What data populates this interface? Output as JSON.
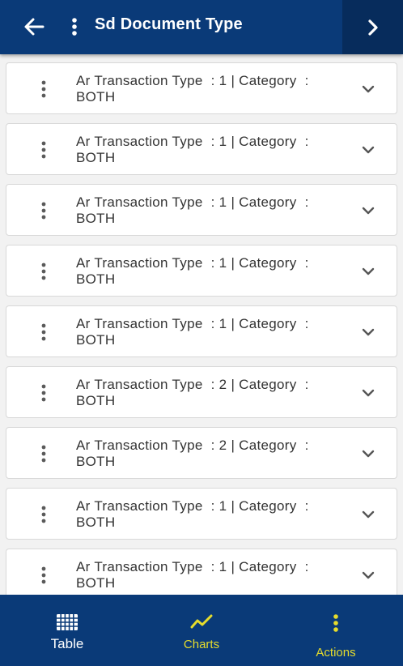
{
  "app_bar": {
    "title": "Sd Document Type",
    "back_icon": "arrow-left-icon",
    "menu_icon": "more-vert-icon",
    "next_icon": "chevron-right-icon"
  },
  "list": {
    "items": [
      {
        "line1": "Ar Transaction Type  : 1 | Category  :",
        "line2": "BOTH"
      },
      {
        "line1": "Ar Transaction Type  : 1 | Category  :",
        "line2": "BOTH"
      },
      {
        "line1": "Ar Transaction Type  : 1 | Category  :",
        "line2": "BOTH"
      },
      {
        "line1": "Ar Transaction Type  : 1 | Category  :",
        "line2": "BOTH"
      },
      {
        "line1": "Ar Transaction Type  : 1 | Category  :",
        "line2": "BOTH"
      },
      {
        "line1": "Ar Transaction Type  : 2 | Category  :",
        "line2": "BOTH"
      },
      {
        "line1": "Ar Transaction Type  : 2 | Category  :",
        "line2": "BOTH"
      },
      {
        "line1": "Ar Transaction Type  : 1 | Category  :",
        "line2": "BOTH"
      },
      {
        "line1": "Ar Transaction Type  : 1 | Category  :",
        "line2": "BOTH"
      }
    ]
  },
  "bottom_nav": {
    "table_label": "Table",
    "charts_label": "Charts",
    "actions_label": "Actions",
    "table_icon": "grid-icon",
    "charts_icon": "trend-line-icon",
    "actions_icon": "more-vert-icon"
  },
  "colors": {
    "primary": "#0a3a78",
    "accent": "#e6dc2c",
    "background": "#f2f2f2"
  }
}
